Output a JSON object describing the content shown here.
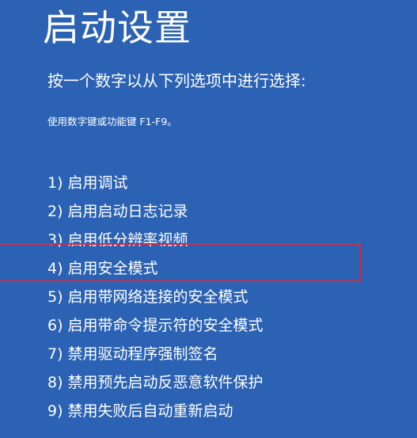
{
  "screen": {
    "title": "启动设置",
    "prompt": "按一个数字以从下列选项中进行选择:",
    "hint": "使用数字键或功能键 F1-F9。",
    "options": [
      {
        "label": "1) 启用调试"
      },
      {
        "label": "2) 启用启动日志记录"
      },
      {
        "label": "3) 启用低分辨率视频"
      },
      {
        "label": "4) 启用安全模式"
      },
      {
        "label": "5) 启用带网络连接的安全模式"
      },
      {
        "label": "6) 启用带命令提示符的安全模式"
      },
      {
        "label": "7) 禁用驱动程序强制签名"
      },
      {
        "label": "8) 禁用预先启动反恶意软件保护"
      },
      {
        "label": "9) 禁用失败后自动重新启动"
      }
    ]
  },
  "colors": {
    "background": "#2b62b4",
    "text": "#ffffff",
    "highlight_border": "#e0263a"
  }
}
